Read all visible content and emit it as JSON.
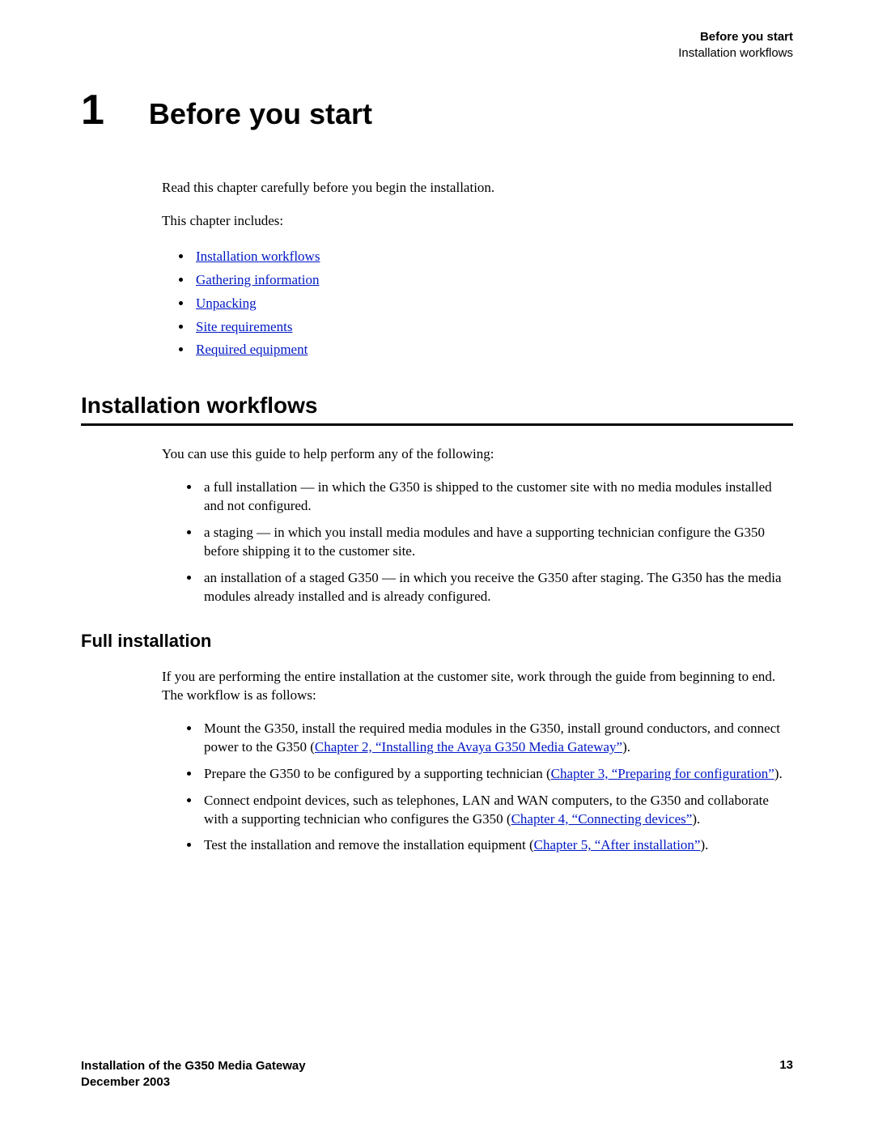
{
  "header": {
    "bold": "Before you start",
    "sub": "Installation workflows"
  },
  "chapter": {
    "number": "1",
    "title": "Before you start"
  },
  "intro": {
    "p1": "Read this chapter carefully before you begin the installation.",
    "p2": "This chapter includes:",
    "links": {
      "i0": "Installation workflows",
      "i1": "Gathering information",
      "i2": "Unpacking",
      "i3": "Site requirements",
      "i4": "Required equipment"
    }
  },
  "section": {
    "title": "Installation workflows",
    "intro": "You can use this guide to help perform any of the following:",
    "items": {
      "b0": "a full installation — in which the G350 is shipped to the customer site with no media modules installed and not configured.",
      "b1": "a staging — in which you install media modules and have a supporting technician configure the G350 before shipping it to the customer site.",
      "b2": "an installation of a staged G350 — in which you receive the G350 after staging. The G350 has the media modules already installed and is already configured."
    }
  },
  "sub": {
    "title": "Full installation",
    "intro": "If you are performing the entire installation at the customer site, work through the guide from beginning to end. The workflow is as follows:",
    "items": {
      "c0_pre": "Mount the G350, install the required media modules in the G350, install ground conductors, and connect power to the G350 (",
      "c0_link": "Chapter 2, “Installing the Avaya G350 Media Gateway”",
      "c0_post": ").",
      "c1_pre": "Prepare the G350 to be configured by a supporting technician (",
      "c1_link": "Chapter 3, “Preparing for configuration”",
      "c1_post": ").",
      "c2_pre": "Connect endpoint devices, such as telephones, LAN and WAN computers, to the G350 and collaborate with a supporting technician who configures the G350 (",
      "c2_link": "Chapter 4, “Connecting devices”",
      "c2_post": ").",
      "c3_pre": "Test the installation and remove the installation equipment (",
      "c3_link": "Chapter 5, “After installation”",
      "c3_post": ")."
    }
  },
  "footer": {
    "title": "Installation of the G350 Media Gateway",
    "date": "December 2003",
    "page": "13"
  }
}
